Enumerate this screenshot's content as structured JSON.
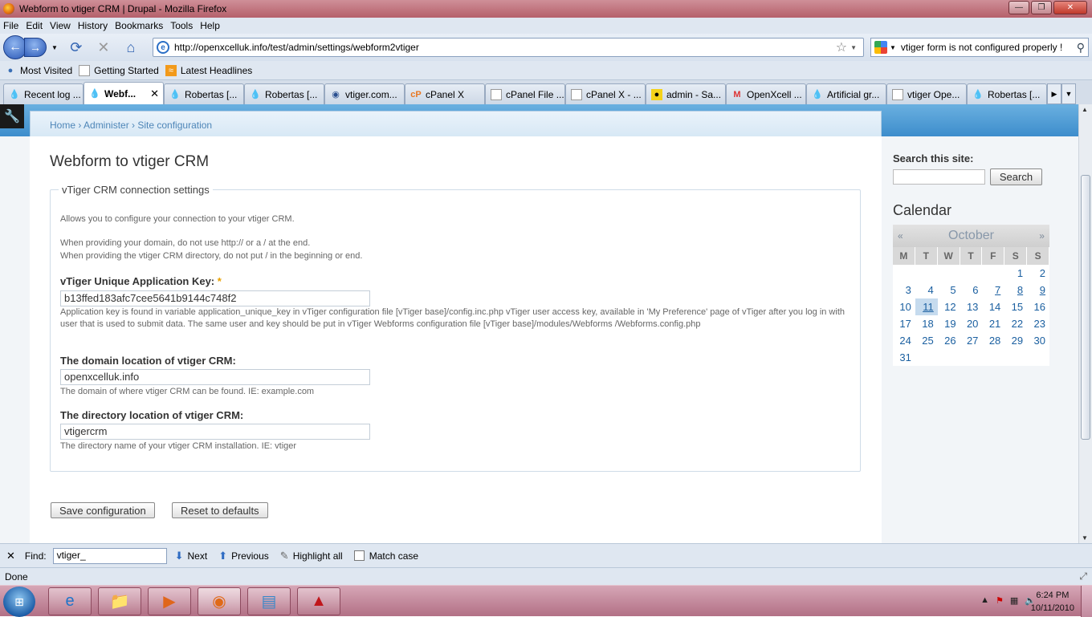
{
  "window": {
    "title": "Webform to vtiger CRM | Drupal - Mozilla Firefox",
    "minimize": "—",
    "maximize": "❐",
    "close": "✕"
  },
  "menu": [
    "File",
    "Edit",
    "View",
    "History",
    "Bookmarks",
    "Tools",
    "Help"
  ],
  "nav": {
    "url": "http://openxcelluk.info/test/admin/settings/webform2vtiger",
    "search_text": "vtiger form is not configured properly !"
  },
  "bookmarks": [
    "Most Visited",
    "Getting Started",
    "Latest Headlines"
  ],
  "tabs": [
    {
      "label": "Recent log ...",
      "icon": "drupal-icon"
    },
    {
      "label": "Webf...",
      "icon": "drupal-icon",
      "active": true
    },
    {
      "label": "Robertas [...",
      "icon": "drupal-icon"
    },
    {
      "label": "Robertas [...",
      "icon": "drupal-icon"
    },
    {
      "label": "vtiger.com...",
      "icon": "vtiger-icon"
    },
    {
      "label": "cPanel X",
      "icon": "cpanel-icon"
    },
    {
      "label": "cPanel File ...",
      "icon": "page-icon"
    },
    {
      "label": "cPanel X - ...",
      "icon": "page-icon"
    },
    {
      "label": "admin - Sa...",
      "icon": "sa-icon"
    },
    {
      "label": "OpenXcell ...",
      "icon": "gmail-icon"
    },
    {
      "label": "Artificial gr...",
      "icon": "drupal-icon"
    },
    {
      "label": "vtiger Ope...",
      "icon": "page-icon"
    },
    {
      "label": "Robertas [...",
      "icon": "drupal-icon"
    }
  ],
  "breadcrumb": "Home › Administer › Site configuration",
  "page": {
    "title": "Webform to vtiger CRM",
    "fieldset_legend": "vTiger CRM connection settings",
    "intro": "Allows you to configure your connection to your vtiger CRM.",
    "note1": "When providing your domain, do not use http:// or a / at the end.",
    "note2": "When providing the vtiger CRM directory, do not put / in the beginning or end.",
    "key_label": "vTiger Unique Application Key:",
    "key_required": "*",
    "key_value": "b13ffed183afc7cee5641b9144c748f2",
    "key_desc": "Application key is found in variable application_unique_key in vTiger configuration file [vTiger base]/config.inc.php vTiger user access key, available in 'My Preference' page of vTiger after you log in with user that is used to submit data. The same user and key should be put in vTiger Webforms configuration file [vTiger base]/modules/Webforms /Webforms.config.php",
    "domain_label": "The domain location of vtiger CRM:",
    "domain_value": "openxcelluk.info",
    "domain_desc": "The domain of where vtiger CRM can be found. IE: example.com",
    "dir_label": "The directory location of vtiger CRM:",
    "dir_value": "vtigercrm",
    "dir_desc": "The directory name of your vtiger CRM installation. IE: vtiger",
    "save_button": "Save configuration",
    "reset_button": "Reset to defaults"
  },
  "sidebar": {
    "search_title": "Search this site:",
    "search_button": "Search",
    "calendar_title": "Calendar",
    "month": "October",
    "prev": "«",
    "next": "»",
    "weekdays": [
      "M",
      "T",
      "W",
      "T",
      "F",
      "S",
      "S"
    ],
    "days": [
      "",
      "",
      "",
      "",
      "",
      "1",
      "2",
      "3",
      "4",
      "5",
      "6",
      "7",
      "8",
      "9",
      "10",
      "11",
      "12",
      "13",
      "14",
      "15",
      "16",
      "17",
      "18",
      "19",
      "20",
      "21",
      "22",
      "23",
      "24",
      "25",
      "26",
      "27",
      "28",
      "29",
      "30",
      "31"
    ],
    "linked_days": [
      "7",
      "8",
      "9",
      "11"
    ],
    "today": "11"
  },
  "findbar": {
    "label": "Find:",
    "value": "vtiger_",
    "next": "Next",
    "previous": "Previous",
    "highlight": "Highlight all",
    "match_case": "Match case"
  },
  "status": "Done",
  "clock": {
    "time": "6:24 PM",
    "date": "10/11/2010"
  }
}
